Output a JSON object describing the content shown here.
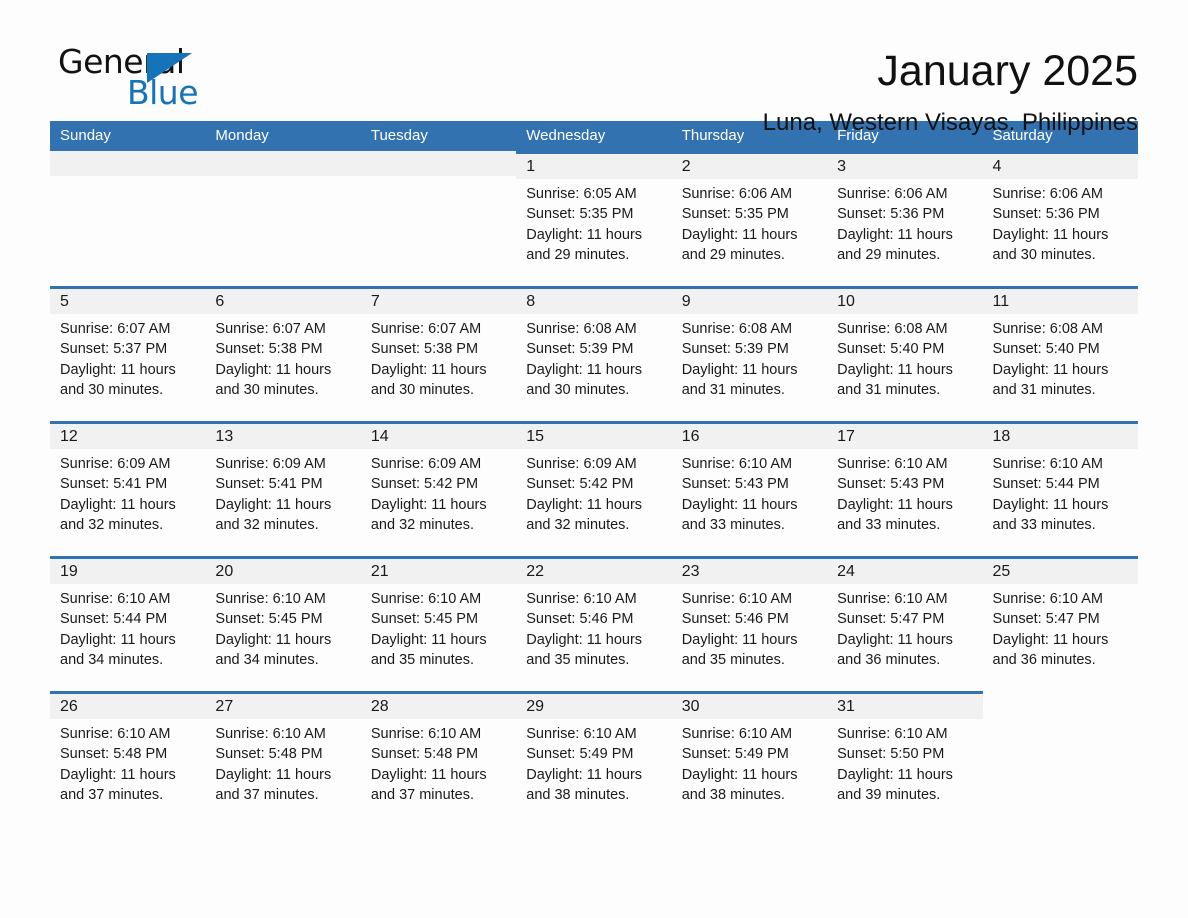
{
  "brand": {
    "name_part1": "General",
    "name_part2": "Blue",
    "accent_color": "#1573ba",
    "triangle_icon": "triangle-icon"
  },
  "header": {
    "title": "January 2025",
    "subtitle": "Luna, Western Visayas, Philippines"
  },
  "calendar": {
    "header_bg": "#3372b0",
    "day_band_bg": "#f1f1f1",
    "weekdays": [
      "Sunday",
      "Monday",
      "Tuesday",
      "Wednesday",
      "Thursday",
      "Friday",
      "Saturday"
    ],
    "weeks": [
      [
        {
          "day": "",
          "sunrise": "",
          "sunset": "",
          "daylight_line1": "",
          "daylight_line2": "",
          "state": "empty"
        },
        {
          "day": "",
          "sunrise": "",
          "sunset": "",
          "daylight_line1": "",
          "daylight_line2": "",
          "state": "empty"
        },
        {
          "day": "",
          "sunrise": "",
          "sunset": "",
          "daylight_line1": "",
          "daylight_line2": "",
          "state": "empty"
        },
        {
          "day": "1",
          "sunrise": "Sunrise: 6:05 AM",
          "sunset": "Sunset: 5:35 PM",
          "daylight_line1": "Daylight: 11 hours",
          "daylight_line2": "and 29 minutes.",
          "state": "filled"
        },
        {
          "day": "2",
          "sunrise": "Sunrise: 6:06 AM",
          "sunset": "Sunset: 5:35 PM",
          "daylight_line1": "Daylight: 11 hours",
          "daylight_line2": "and 29 minutes.",
          "state": "filled"
        },
        {
          "day": "3",
          "sunrise": "Sunrise: 6:06 AM",
          "sunset": "Sunset: 5:36 PM",
          "daylight_line1": "Daylight: 11 hours",
          "daylight_line2": "and 29 minutes.",
          "state": "filled"
        },
        {
          "day": "4",
          "sunrise": "Sunrise: 6:06 AM",
          "sunset": "Sunset: 5:36 PM",
          "daylight_line1": "Daylight: 11 hours",
          "daylight_line2": "and 30 minutes.",
          "state": "filled"
        }
      ],
      [
        {
          "day": "5",
          "sunrise": "Sunrise: 6:07 AM",
          "sunset": "Sunset: 5:37 PM",
          "daylight_line1": "Daylight: 11 hours",
          "daylight_line2": "and 30 minutes.",
          "state": "filled"
        },
        {
          "day": "6",
          "sunrise": "Sunrise: 6:07 AM",
          "sunset": "Sunset: 5:38 PM",
          "daylight_line1": "Daylight: 11 hours",
          "daylight_line2": "and 30 minutes.",
          "state": "filled"
        },
        {
          "day": "7",
          "sunrise": "Sunrise: 6:07 AM",
          "sunset": "Sunset: 5:38 PM",
          "daylight_line1": "Daylight: 11 hours",
          "daylight_line2": "and 30 minutes.",
          "state": "filled"
        },
        {
          "day": "8",
          "sunrise": "Sunrise: 6:08 AM",
          "sunset": "Sunset: 5:39 PM",
          "daylight_line1": "Daylight: 11 hours",
          "daylight_line2": "and 30 minutes.",
          "state": "filled"
        },
        {
          "day": "9",
          "sunrise": "Sunrise: 6:08 AM",
          "sunset": "Sunset: 5:39 PM",
          "daylight_line1": "Daylight: 11 hours",
          "daylight_line2": "and 31 minutes.",
          "state": "filled"
        },
        {
          "day": "10",
          "sunrise": "Sunrise: 6:08 AM",
          "sunset": "Sunset: 5:40 PM",
          "daylight_line1": "Daylight: 11 hours",
          "daylight_line2": "and 31 minutes.",
          "state": "filled"
        },
        {
          "day": "11",
          "sunrise": "Sunrise: 6:08 AM",
          "sunset": "Sunset: 5:40 PM",
          "daylight_line1": "Daylight: 11 hours",
          "daylight_line2": "and 31 minutes.",
          "state": "filled"
        }
      ],
      [
        {
          "day": "12",
          "sunrise": "Sunrise: 6:09 AM",
          "sunset": "Sunset: 5:41 PM",
          "daylight_line1": "Daylight: 11 hours",
          "daylight_line2": "and 32 minutes.",
          "state": "filled"
        },
        {
          "day": "13",
          "sunrise": "Sunrise: 6:09 AM",
          "sunset": "Sunset: 5:41 PM",
          "daylight_line1": "Daylight: 11 hours",
          "daylight_line2": "and 32 minutes.",
          "state": "filled"
        },
        {
          "day": "14",
          "sunrise": "Sunrise: 6:09 AM",
          "sunset": "Sunset: 5:42 PM",
          "daylight_line1": "Daylight: 11 hours",
          "daylight_line2": "and 32 minutes.",
          "state": "filled"
        },
        {
          "day": "15",
          "sunrise": "Sunrise: 6:09 AM",
          "sunset": "Sunset: 5:42 PM",
          "daylight_line1": "Daylight: 11 hours",
          "daylight_line2": "and 32 minutes.",
          "state": "filled"
        },
        {
          "day": "16",
          "sunrise": "Sunrise: 6:10 AM",
          "sunset": "Sunset: 5:43 PM",
          "daylight_line1": "Daylight: 11 hours",
          "daylight_line2": "and 33 minutes.",
          "state": "filled"
        },
        {
          "day": "17",
          "sunrise": "Sunrise: 6:10 AM",
          "sunset": "Sunset: 5:43 PM",
          "daylight_line1": "Daylight: 11 hours",
          "daylight_line2": "and 33 minutes.",
          "state": "filled"
        },
        {
          "day": "18",
          "sunrise": "Sunrise: 6:10 AM",
          "sunset": "Sunset: 5:44 PM",
          "daylight_line1": "Daylight: 11 hours",
          "daylight_line2": "and 33 minutes.",
          "state": "filled"
        }
      ],
      [
        {
          "day": "19",
          "sunrise": "Sunrise: 6:10 AM",
          "sunset": "Sunset: 5:44 PM",
          "daylight_line1": "Daylight: 11 hours",
          "daylight_line2": "and 34 minutes.",
          "state": "filled"
        },
        {
          "day": "20",
          "sunrise": "Sunrise: 6:10 AM",
          "sunset": "Sunset: 5:45 PM",
          "daylight_line1": "Daylight: 11 hours",
          "daylight_line2": "and 34 minutes.",
          "state": "filled"
        },
        {
          "day": "21",
          "sunrise": "Sunrise: 6:10 AM",
          "sunset": "Sunset: 5:45 PM",
          "daylight_line1": "Daylight: 11 hours",
          "daylight_line2": "and 35 minutes.",
          "state": "filled"
        },
        {
          "day": "22",
          "sunrise": "Sunrise: 6:10 AM",
          "sunset": "Sunset: 5:46 PM",
          "daylight_line1": "Daylight: 11 hours",
          "daylight_line2": "and 35 minutes.",
          "state": "filled"
        },
        {
          "day": "23",
          "sunrise": "Sunrise: 6:10 AM",
          "sunset": "Sunset: 5:46 PM",
          "daylight_line1": "Daylight: 11 hours",
          "daylight_line2": "and 35 minutes.",
          "state": "filled"
        },
        {
          "day": "24",
          "sunrise": "Sunrise: 6:10 AM",
          "sunset": "Sunset: 5:47 PM",
          "daylight_line1": "Daylight: 11 hours",
          "daylight_line2": "and 36 minutes.",
          "state": "filled"
        },
        {
          "day": "25",
          "sunrise": "Sunrise: 6:10 AM",
          "sunset": "Sunset: 5:47 PM",
          "daylight_line1": "Daylight: 11 hours",
          "daylight_line2": "and 36 minutes.",
          "state": "filled"
        }
      ],
      [
        {
          "day": "26",
          "sunrise": "Sunrise: 6:10 AM",
          "sunset": "Sunset: 5:48 PM",
          "daylight_line1": "Daylight: 11 hours",
          "daylight_line2": "and 37 minutes.",
          "state": "filled"
        },
        {
          "day": "27",
          "sunrise": "Sunrise: 6:10 AM",
          "sunset": "Sunset: 5:48 PM",
          "daylight_line1": "Daylight: 11 hours",
          "daylight_line2": "and 37 minutes.",
          "state": "filled"
        },
        {
          "day": "28",
          "sunrise": "Sunrise: 6:10 AM",
          "sunset": "Sunset: 5:48 PM",
          "daylight_line1": "Daylight: 11 hours",
          "daylight_line2": "and 37 minutes.",
          "state": "filled"
        },
        {
          "day": "29",
          "sunrise": "Sunrise: 6:10 AM",
          "sunset": "Sunset: 5:49 PM",
          "daylight_line1": "Daylight: 11 hours",
          "daylight_line2": "and 38 minutes.",
          "state": "filled"
        },
        {
          "day": "30",
          "sunrise": "Sunrise: 6:10 AM",
          "sunset": "Sunset: 5:49 PM",
          "daylight_line1": "Daylight: 11 hours",
          "daylight_line2": "and 38 minutes.",
          "state": "filled"
        },
        {
          "day": "31",
          "sunrise": "Sunrise: 6:10 AM",
          "sunset": "Sunset: 5:50 PM",
          "daylight_line1": "Daylight: 11 hours",
          "daylight_line2": "and 39 minutes.",
          "state": "filled"
        },
        {
          "day": "",
          "sunrise": "",
          "sunset": "",
          "daylight_line1": "",
          "daylight_line2": "",
          "state": "blank-tail"
        }
      ]
    ]
  }
}
